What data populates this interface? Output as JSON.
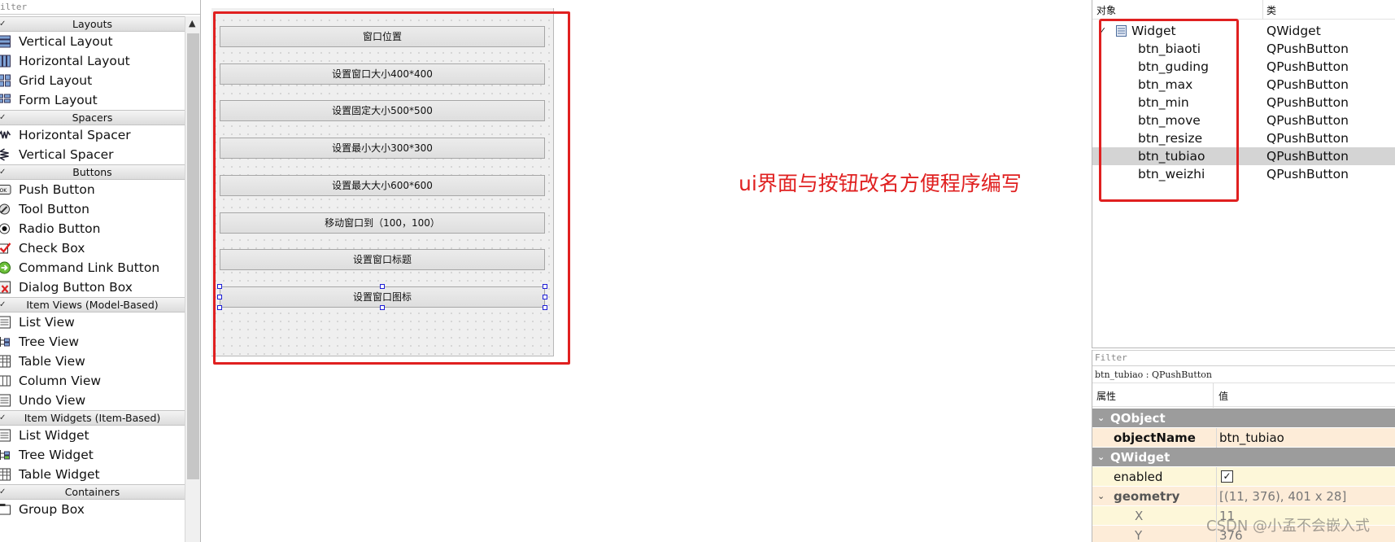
{
  "widget_box": {
    "filter_placeholder": "ilter",
    "groups": [
      {
        "label": "Layouts",
        "items": [
          {
            "label": "Vertical Layout",
            "icon": "vertical-layout-icon"
          },
          {
            "label": "Horizontal Layout",
            "icon": "horizontal-layout-icon"
          },
          {
            "label": "Grid Layout",
            "icon": "grid-layout-icon"
          },
          {
            "label": "Form Layout",
            "icon": "form-layout-icon"
          }
        ]
      },
      {
        "label": "Spacers",
        "items": [
          {
            "label": "Horizontal Spacer",
            "icon": "horizontal-spacer-icon"
          },
          {
            "label": "Vertical Spacer",
            "icon": "vertical-spacer-icon"
          }
        ]
      },
      {
        "label": "Buttons",
        "items": [
          {
            "label": "Push Button",
            "icon": "push-button-icon"
          },
          {
            "label": "Tool Button",
            "icon": "tool-button-icon"
          },
          {
            "label": "Radio Button",
            "icon": "radio-button-icon"
          },
          {
            "label": "Check Box",
            "icon": "check-box-icon"
          },
          {
            "label": "Command Link Button",
            "icon": "command-link-icon"
          },
          {
            "label": "Dialog Button Box",
            "icon": "dialog-button-box-icon"
          }
        ]
      },
      {
        "label": "Item Views (Model-Based)",
        "items": [
          {
            "label": "List View",
            "icon": "list-view-icon"
          },
          {
            "label": "Tree View",
            "icon": "tree-view-icon"
          },
          {
            "label": "Table View",
            "icon": "table-view-icon"
          },
          {
            "label": "Column View",
            "icon": "column-view-icon"
          },
          {
            "label": "Undo View",
            "icon": "undo-view-icon"
          }
        ]
      },
      {
        "label": "Item Widgets (Item-Based)",
        "items": [
          {
            "label": "List Widget",
            "icon": "list-widget-icon"
          },
          {
            "label": "Tree Widget",
            "icon": "tree-widget-icon"
          },
          {
            "label": "Table Widget",
            "icon": "table-widget-icon"
          }
        ]
      },
      {
        "label": "Containers",
        "items": [
          {
            "label": "Group Box",
            "icon": "group-box-icon"
          }
        ]
      }
    ]
  },
  "form": {
    "buttons": [
      "窗口位置",
      "设置窗口大小400*400",
      "设置固定大小500*500",
      "设置最小大小300*300",
      "设置最大大小600*600",
      "移动窗口到（100，100）",
      "设置窗口标题",
      "设置窗口图标"
    ],
    "annotation": "ui界面与按钮改名方便程序编写",
    "annotation_color": "#e02020"
  },
  "object_inspector": {
    "col_object": "对象",
    "col_class": "类",
    "root": {
      "name": "Widget",
      "class": "QWidget"
    },
    "children": [
      {
        "name": "btn_biaoti",
        "class": "QPushButton"
      },
      {
        "name": "btn_guding",
        "class": "QPushButton"
      },
      {
        "name": "btn_max",
        "class": "QPushButton"
      },
      {
        "name": "btn_min",
        "class": "QPushButton"
      },
      {
        "name": "btn_move",
        "class": "QPushButton"
      },
      {
        "name": "btn_resize",
        "class": "QPushButton"
      },
      {
        "name": "btn_tubiao",
        "class": "QPushButton",
        "selected": true
      },
      {
        "name": "btn_weizhi",
        "class": "QPushButton"
      }
    ]
  },
  "property_editor": {
    "filter_placeholder": "Filter",
    "object_label": "btn_tubiao : QPushButton",
    "col_property": "属性",
    "col_value": "值",
    "qobject_group": "QObject",
    "object_name_label": "objectName",
    "object_name_value": "btn_tubiao",
    "qwidget_group": "QWidget",
    "enabled_label": "enabled",
    "enabled_checked": true,
    "geometry_label": "geometry",
    "geometry_value": "[(11, 376), 401 x 28]",
    "x_label": "X",
    "x_value": "11",
    "y_label": "Y",
    "y_value": "376"
  },
  "watermark": "CSDN @小孟不会嵌入式"
}
